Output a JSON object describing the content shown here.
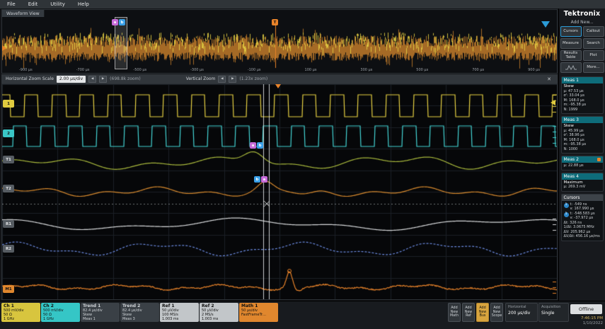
{
  "menu": {
    "items": [
      "File",
      "Edit",
      "Utility",
      "Help"
    ]
  },
  "brand": {
    "logo": "Tektronix",
    "add_new": "Add New..."
  },
  "add_new_buttons": [
    {
      "label": "Cursors"
    },
    {
      "label": "Callout"
    },
    {
      "label": "Measure"
    },
    {
      "label": "Search"
    },
    {
      "label": "Results Table"
    },
    {
      "label": "Plot"
    },
    {
      "label": ""
    },
    {
      "label": "More..."
    }
  ],
  "overview": {
    "tab": "Waveform View",
    "axis_labels": [
      "-900 μs",
      "-700 μs",
      "-500 μs",
      "-300 μs",
      "-100 μs",
      "100 μs",
      "300 μs",
      "500 μs",
      "700 μs",
      "900 μs"
    ],
    "cursor_a": "a",
    "cursor_b": "b",
    "trigger": "T"
  },
  "zoom_bar": {
    "h_label": "Horizontal Zoom Scale",
    "h_value": "2.00 μs/div",
    "dec": "◀",
    "inc": "▶",
    "h_zoom": "(698.8k zoom)",
    "v_label": "Vertical Zoom",
    "v_zoom": "(1.23x zoom)",
    "close": "✕"
  },
  "grid_markers": {
    "left": [
      "1",
      "2",
      "T1",
      "T2",
      "R1",
      "R2",
      "M1"
    ],
    "cursor_a": "a",
    "cursor_b": "b"
  },
  "measurements": [
    {
      "id": "Meas 1",
      "name": "Skew",
      "lines": [
        "μ: 47.53 μs",
        "σ': 33.04 μs",
        "M: 168.0 μs",
        "m: -95.38 μs",
        "N: 1999"
      ]
    },
    {
      "id": "Meas 3",
      "name": "Skew",
      "lines": [
        "μ: 45.99 μs",
        "σ': 38.96 μs",
        "M: 168.0 μs",
        "m: -95.38 μs",
        "N: 1000"
      ]
    },
    {
      "id": "Meas 2",
      "name": "Skew",
      "lines": [
        "μ: 22.88 μs"
      ]
    },
    {
      "id": "Meas 4",
      "name": "Maximum",
      "lines": [
        "μ: 269.3 mV"
      ]
    }
  ],
  "cursors_panel": {
    "title": "Cursors",
    "rows": [
      {
        "icon": "1",
        "l1": "t: -549 ns",
        "l2": "v: 167.990 μs"
      },
      {
        "icon": "1",
        "l1": "t: -548.583 μs",
        "l2": "v: -37.972 μs"
      },
      {
        "l1": "Δt: 326 ns",
        "l2": "1/Δt: 3.0675 MHz"
      },
      {
        "l1": "ΔV: 205.962 μs",
        "l2": "ΔV/Δt: 456.16 μs/ms"
      }
    ]
  },
  "channels": [
    {
      "id": "Ch 1",
      "lines": [
        "500 mV/div",
        "50 Ω",
        "1 GHz"
      ]
    },
    {
      "id": "Ch 2",
      "lines": [
        "500 mV/div",
        "50 Ω",
        "1 GHz"
      ]
    },
    {
      "id": "Trend 1",
      "lines": [
        "82.4 μs/div",
        "Skew",
        "Meas 1"
      ]
    },
    {
      "id": "Trend 2",
      "lines": [
        "82.4 μs/div",
        "Skew",
        "Meas 3"
      ]
    },
    {
      "id": "Ref 1",
      "lines": [
        "50 μV/div",
        "100 MS/s",
        "1.003 ms"
      ]
    },
    {
      "id": "Ref 2",
      "lines": [
        "50 μV/div",
        "2 MS/s",
        "1.003 ms"
      ]
    },
    {
      "id": "Math 1",
      "lines": [
        "50 μs/div",
        "FastFrameTr…",
        ""
      ]
    }
  ],
  "bottom_add_buttons": [
    {
      "label": "Add New Math"
    },
    {
      "label": "Add New Ref"
    },
    {
      "label": "Add New Bus"
    },
    {
      "label": "Add New Scope"
    }
  ],
  "horizontal_panel": {
    "title": "Horizontal",
    "value": "200 μs/div"
  },
  "acquisition_panel": {
    "title": "Acquisition",
    "value": "Single"
  },
  "offline_button": "Offline",
  "clock": {
    "time": "7:46:15 PM",
    "date": "1/10/2022"
  },
  "colors": {
    "accent": "#2b9bd7",
    "ch1": "#e8d243",
    "ch2": "#45d7d7",
    "trend1": "#a8b83c",
    "trend2": "#d88a2e",
    "ref1": "#d8dadc",
    "ref2": "#6b8ae0",
    "math1": "#e8832a",
    "grid": "#1c2127",
    "marker_a": "#c76bd9",
    "marker_b": "#3aa0e8"
  }
}
